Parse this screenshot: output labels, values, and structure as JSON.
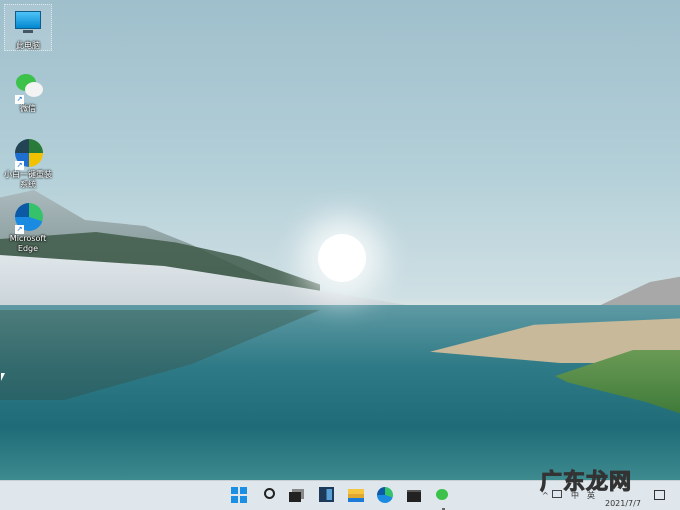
{
  "desktop": {
    "icons": [
      {
        "label": "此电脑",
        "icon": "this-pc-icon"
      },
      {
        "label": "微信",
        "icon": "wechat-icon"
      },
      {
        "label": "小白一键重装系统",
        "icon": "xiaobai-reinstall-icon"
      },
      {
        "label": "Microsoft Edge",
        "icon": "edge-icon"
      }
    ]
  },
  "taskbar": {
    "items": [
      "start",
      "search",
      "task-view",
      "widgets",
      "file-explorer",
      "edge",
      "store",
      "wechat"
    ],
    "tray": {
      "ime": "中",
      "lang": "英",
      "date": "2021/7/7"
    }
  },
  "watermark": "广东龙网",
  "colors": {
    "taskbar": "#dfe7ec",
    "accent": "#0078d4"
  }
}
